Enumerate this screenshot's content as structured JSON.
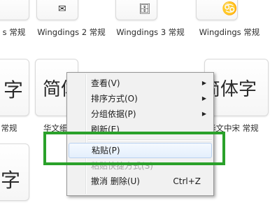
{
  "top_row": {
    "labels": [
      "s 常规",
      "Wingdings 2 常规",
      "Wingdings 3 常规",
      "Wingdings 常规"
    ]
  },
  "middle_row": {
    "glyphs": [
      "字",
      "简体",
      "简体字"
    ],
    "labels": [
      "常规",
      "华文细",
      "华文中宋 常规"
    ]
  },
  "bottom_row": {
    "glyphs": [
      "字"
    ]
  },
  "top_glyphs": [
    "✉",
    "📁",
    "🗄",
    "♋"
  ],
  "context_menu": {
    "view": "查看(V)",
    "sort_by": "排序方式(O)",
    "group_by": "分组依据(P)",
    "refresh": "刷新(E)",
    "paste": "粘贴(P)",
    "paste_shortcut": "粘贴快捷方式(S)",
    "undo_delete": "撤消 删除(U)",
    "undo_shortcut": "Ctrl+Z",
    "submenu_arrow": "▶"
  },
  "highlight_color": "#2aa12a"
}
